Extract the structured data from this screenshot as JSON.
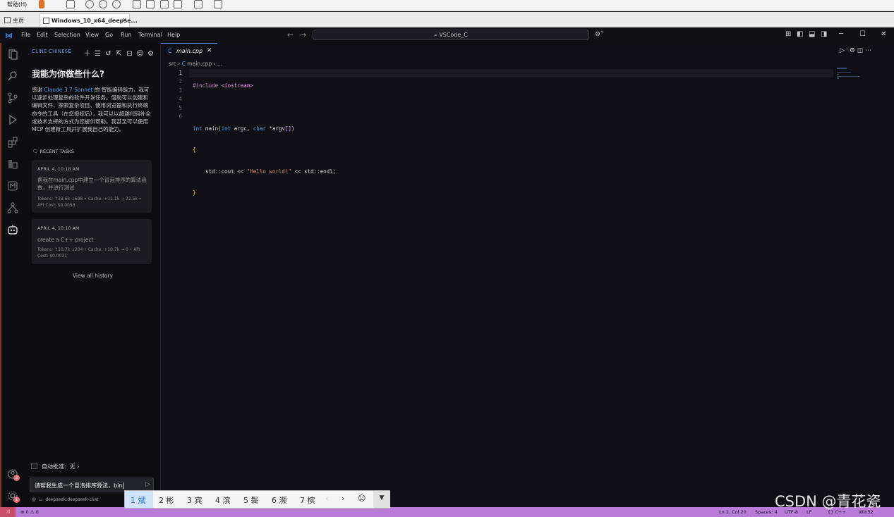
{
  "vm_toolbar": {
    "help_menu": "帮助(H)"
  },
  "vm_tabs": [
    {
      "label": "主页"
    },
    {
      "label": "Windows_10_x64_deepse..."
    }
  ],
  "window": {
    "menus": [
      "File",
      "Edit",
      "Selection",
      "View",
      "Go",
      "Run",
      "Terminal",
      "Help"
    ],
    "search_text": "VSCode_C"
  },
  "sidebar": {
    "panel_title": "CLINE CHINESE",
    "heading": "我能为你做些什么?",
    "intro_prefix": "感谢 ",
    "intro_highlight": "Claude 3.7 Sonnet",
    "intro_rest": " 的 智能编码能力，我可以逐步处理复杂的软件开发任务。借助可以创建和编辑文件、探索复杂项目、使用浏览器和执行终端命令的工具（在您授权后），我可以以超越代码补全或技术支持的方式为您提供帮助。我甚至可以使用 MCP 创建新工具并扩展我自己的能力。",
    "recent_label": "RECENT TASKS",
    "tasks": [
      {
        "date": "APRIL 4, 10:18 AM",
        "title": "帮我在main.cpp中建立一个冒泡排序的算法函数，并进行测试",
        "stats": "Tokens: ↑33.6k ↓698 • Cache: +11.1k → 22.5k • API Cost: $0.0053"
      },
      {
        "date": "APRIL 4, 10:10 AM",
        "title": "create  a C++ project",
        "stats": "Tokens: ↑10.7k ↓204 • Cache: +10.7k → 0 • API Cost: $0.0031"
      }
    ],
    "view_all": "View all history",
    "auto_approve_label": "自动批准:",
    "auto_approve_value": "无",
    "chat_input": "请帮我生成一个冒泡排序算法，bin",
    "model": "deepseek:deepseek-chat"
  },
  "editor": {
    "tab_label": "main.cpp",
    "breadcrumb_src": "src",
    "breadcrumb_file": "main.cpp",
    "breadcrumb_more": "...",
    "line_numbers": [
      "1",
      "2",
      "3",
      "4",
      "5",
      "6"
    ]
  },
  "ime": {
    "candidates": [
      "1 斌",
      "2 彬",
      "3 宾",
      "4 滨",
      "5 鬓",
      "6 濒",
      "7 槟"
    ]
  },
  "status": {
    "left": "⊗ 0 ⚠ 0",
    "position": "Ln 1, Col 20",
    "spaces": "Spaces: 4",
    "encoding": "UTF-8",
    "eol": "LF",
    "language": "{} C++",
    "platform": "Win32"
  },
  "watermark": "CSDN @青花瓷",
  "badges": {
    "accounts": "2",
    "settings": "1"
  },
  "colors": {
    "status_bar": "#b87bd8",
    "accent": "#6a8ecd",
    "link": "#4f9ce6"
  }
}
